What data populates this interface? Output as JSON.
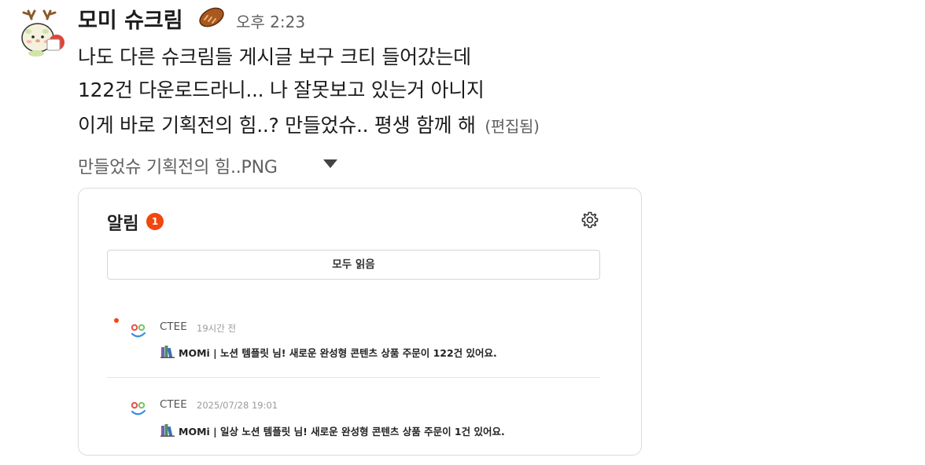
{
  "message": {
    "sender": "모미 슈크림",
    "sender_emoji": "bread-emoji",
    "timestamp": "오후 2:23",
    "lines": [
      "나도 다른 슈크림들 게시글 보구 크티 들어갔는데",
      "122건 다운로드라니... 나 잘못보고 있는거 아니지",
      "이게 바로 기획전의 힘..? 만들었슈.. 평생 함께 해"
    ],
    "edited_label": "(편집됨)"
  },
  "attachment": {
    "filename": "만들었슈 기획전의 힘..PNG",
    "toggle_icon": "caret-down-icon"
  },
  "notification_panel": {
    "title": "알림",
    "unread_count": "1",
    "settings_icon": "gear-icon",
    "read_all_label": "모두 읽음",
    "items": [
      {
        "source": "CTEE",
        "time": "19시간 전",
        "unread": true,
        "icon": "books-icon",
        "text": "MOMi | 노션 템플릿 님! 새로운 완성형 콘텐츠 상품 주문이 122건 있어요."
      },
      {
        "source": "CTEE",
        "time": "2025/07/28 19:01",
        "unread": false,
        "icon": "books-icon",
        "text": "MOMi | 일상 노션 템플릿 님! 새로운 완성형 콘텐츠 상품 주문이 1건 있어요."
      }
    ]
  },
  "colors": {
    "accent_badge": "#f2460f",
    "text_primary": "#1d1c1d",
    "text_secondary": "#616061"
  }
}
